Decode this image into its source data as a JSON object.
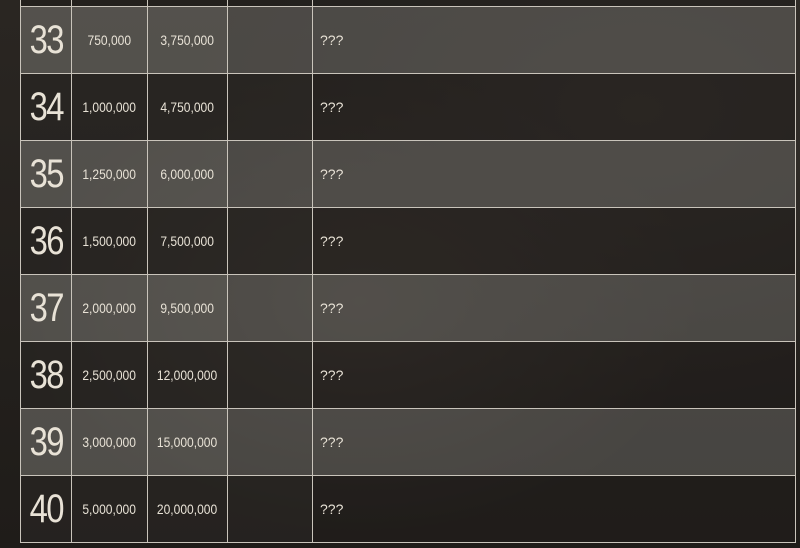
{
  "rows": [
    {
      "level": "33",
      "cost": "750,000",
      "total": "3,750,000",
      "extra": "",
      "note": "???"
    },
    {
      "level": "34",
      "cost": "1,000,000",
      "total": "4,750,000",
      "extra": "",
      "note": "???"
    },
    {
      "level": "35",
      "cost": "1,250,000",
      "total": "6,000,000",
      "extra": "",
      "note": "???"
    },
    {
      "level": "36",
      "cost": "1,500,000",
      "total": "7,500,000",
      "extra": "",
      "note": "???"
    },
    {
      "level": "37",
      "cost": "2,000,000",
      "total": "9,500,000",
      "extra": "",
      "note": "???"
    },
    {
      "level": "38",
      "cost": "2,500,000",
      "total": "12,000,000",
      "extra": "",
      "note": "???"
    },
    {
      "level": "39",
      "cost": "3,000,000",
      "total": "15,000,000",
      "extra": "",
      "note": "???"
    },
    {
      "level": "40",
      "cost": "5,000,000",
      "total": "20,000,000",
      "extra": "",
      "note": "???"
    }
  ],
  "colors": {
    "light_row": "#5e5c59",
    "dark_row": "#2a2724",
    "border": "#c9c4bb",
    "text": "#e8e2d6"
  }
}
